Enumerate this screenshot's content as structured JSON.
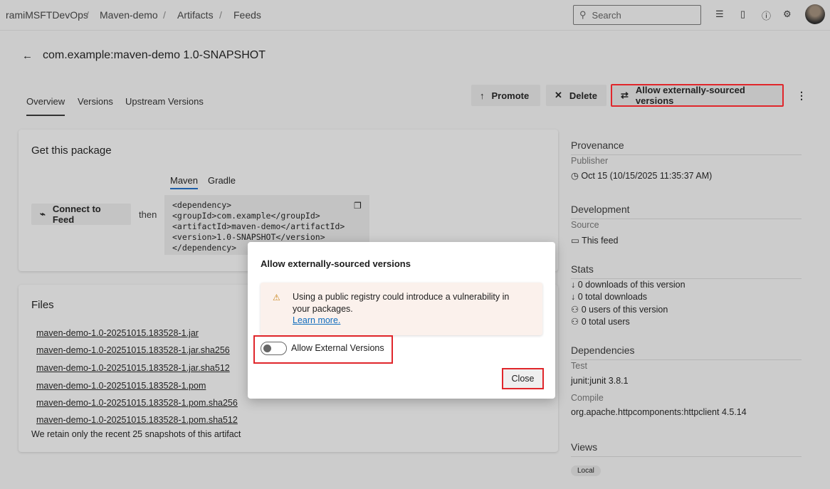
{
  "breadcrumb": [
    "ramiMSFTDevOps",
    "Maven-demo",
    "Artifacts",
    "Feeds"
  ],
  "search": {
    "placeholder": "Search"
  },
  "header": {
    "title": "com.example:maven-demo 1.0-SNAPSHOT"
  },
  "tabs": [
    "Overview",
    "Versions",
    "Upstream Versions"
  ],
  "toolbar": {
    "promote": "Promote",
    "delete": "Delete",
    "allow_external": "Allow externally-sourced versions"
  },
  "get_package": {
    "title": "Get this package",
    "connect": "Connect to Feed",
    "then": "then",
    "code_tabs": [
      "Maven",
      "Gradle"
    ],
    "code": [
      "<dependency>",
      "<groupId>com.example</groupId>",
      "<artifactId>maven-demo</artifactId>",
      "<version>1.0-SNAPSHOT</version>",
      "</dependency>"
    ]
  },
  "files": {
    "title": "Files",
    "items": [
      "maven-demo-1.0-20251015.183528-1.jar",
      "maven-demo-1.0-20251015.183528-1.jar.sha256",
      "maven-demo-1.0-20251015.183528-1.jar.sha512",
      "maven-demo-1.0-20251015.183528-1.pom",
      "maven-demo-1.0-20251015.183528-1.pom.sha256",
      "maven-demo-1.0-20251015.183528-1.pom.sha512"
    ],
    "note": "We retain only the recent 25 snapshots of this artifact"
  },
  "sidebar": {
    "provenance": {
      "title": "Provenance",
      "label": "Publisher",
      "value": "Oct 15 (10/15/2025 11:35:37 AM)"
    },
    "development": {
      "title": "Development",
      "label": "Source",
      "value": "This feed"
    },
    "stats": {
      "title": "Stats",
      "items": [
        "0 downloads of this version",
        "0 total downloads",
        "0 users of this version",
        "0 total users"
      ]
    },
    "dependencies": {
      "title": "Dependencies",
      "test_label": "Test",
      "test_value": "junit:junit 3.8.1",
      "compile_label": "Compile",
      "compile_value": "org.apache.httpcomponents:httpclient 4.5.14"
    },
    "views": {
      "title": "Views",
      "badge": "Local"
    }
  },
  "dialog": {
    "title": "Allow externally-sourced versions",
    "warning": "Using a public registry could introduce a vulnerability in your packages.",
    "learn_more": "Learn more.",
    "toggle_label": "Allow External Versions",
    "toggle_on": false,
    "close": "Close"
  },
  "colors": {
    "highlight": "#e0262b",
    "link": "#0f6cbd",
    "warning_bg": "#fbf1ec",
    "warning_icon": "#c8851a"
  }
}
